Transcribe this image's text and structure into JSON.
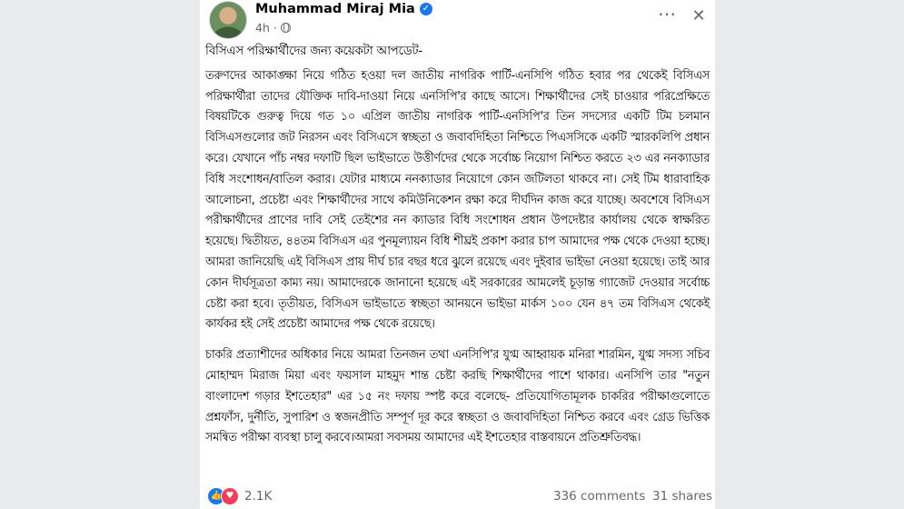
{
  "post": {
    "author": "Muhammad Miraj Mia",
    "time": "4h",
    "title": "বিসিএস পরিক্ষার্থীদের জন্য কয়েকটা আপডেট-",
    "paragraph1": "তরুণদের আকাঙ্ক্ষা নিয়ে গঠিত হওয়া দল জাতীয় নাগরিক পার্টি-এনসিপি গঠিত হবার পর থেকেই বিসিএস পরিক্ষার্থীরা তাদের যৌক্তিক দাবি-দাওয়া নিয়ে এনসিপি'র কাছে আসে। শিক্ষার্থীদের সেই চাওয়ার পরিপ্রেক্ষিতে বিষয়টিকে গুরুত্ব দিয়ে গত ১০ এপ্রিল জাতীয় নাগরিক পার্টি-এনসিপি'র তিন সদস্যের একটি টিম চলমান বিসিএসগুলোর জট নিরসন এবং বিসিএসে স্বচ্ছতা ও জবাবদিহিতা নিশ্চিতে পিএসসিকে একটি স্মারকলিপি প্রধান করে। যেখানে পাঁচ নম্বর দফাটি ছিল ভাইভাতে উত্তীর্ণদের থেকে সর্বোচ্চ নিয়োগ নিশ্চিত করতে ২৩ এর ননক্যাডার বিধি সংশোধন/বাতিল করার। যেটার মাধ্যমে ননক্যাডার নিয়োগে কোন জটিলতা থাকবে না। সেই টিম ধারাবাহিক আলোচনা, প্রচেষ্টা এবং শিক্ষার্থীদের সাথে কমিউনিকেশন রক্ষা করে দীর্ঘদিন কাজ করে যাচ্ছে। অবশেষে বিসিএস পরীক্ষার্থীদের প্রাণের দাবি সেই তেইশের নন ক্যাডার বিধি সংশোধন প্রধান উপদেষ্টার কার্যালয় থেকে স্বাক্ষরিত হয়েছে। দ্বিতীয়ত, ৪৪তম বিসিএস এর পুনমূল্যায়ন বিধি শীঘ্রই প্রকাশ করার চাপ আমাদের পক্ষ থেকে দেওয়া হচ্ছে। আমরা জানিয়েছি এই বিসিএস প্রায় দীর্ঘ চার বছর ধরে ঝুলে রয়েছে এবং দুইবার ভাইভা নেওয়া হয়েছে। তাই আর কোন দীর্ঘসূত্রতা কাম্য নয়। আমাদেরকে জানানো হয়েছে এই সরকারের আমলেই চূড়ান্ত গ্যাজেট দেওয়ার সর্বোচ্চ চেষ্টা করা হবে। তৃতীয়ত, বিসিএস ভাইভাতে স্বচ্ছতা আনয়নে ভাইভা মার্কস ১০০ যেন ৪৭ তম বিসিএস থেকেই কার্যকর হই সেই প্রচেষ্টা আমাদের পক্ষ থেকে রয়েছে।",
    "paragraph2": "চাকরি প্রত্যাশীদের অধিকার নিয়ে আমরা তিনজন তথা এনসিপি'র যুগ্ম আহ্বায়ক মনিরা শারমিন, যুগ্ম সদস্য সচিব মোহাম্মদ মিরাজ মিয়া এবং ফয়সাল মাহমুদ শান্ত চেষ্টা করছি শিক্ষার্থীদের পাশে থাকার। এনসিপি তার \"নতুন বাংলাদেশ গড়ার ইশতেহার\" এর ১৫ নং দফায় স্পষ্ট করে বলেছে- প্রতিযোগিতামূলক চাকরির পরীক্ষাগুলোতে প্রশ্নফাঁস, দুর্নীতি, সুপারিশ ও স্বজনপ্রীতি সম্পূর্ণ দূর করে স্বচ্ছতা ও জবাবদিহিতা নিশ্চিত করবে এবং গ্রেড ভিত্তিক সমন্বিত পরীক্ষা ব্যবস্থা চালু করবে।আমরা সবসময় আমাদের এই ইশতেহার বাস্তবায়নে প্রতিশ্রুতিবদ্ধ।"
  },
  "footer": {
    "reaction_count": "2.1K",
    "comments": "336 comments",
    "shares": "31 shares"
  },
  "colors": {
    "accent": "#1877f2",
    "love": "#f33e58",
    "muted_text": "#65676b",
    "background": "#e4e6eb"
  },
  "icons": {
    "verified": "verified-badge-icon",
    "privacy": "globe-icon",
    "more": "more-horizontal-icon",
    "close": "close-icon",
    "like": "like-icon",
    "love": "love-icon"
  }
}
